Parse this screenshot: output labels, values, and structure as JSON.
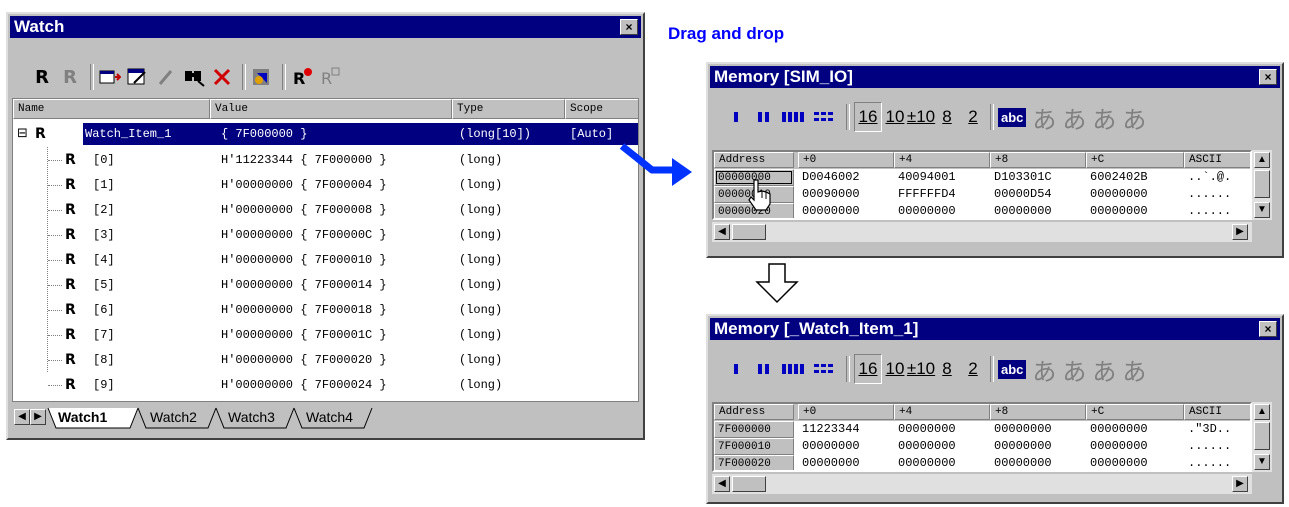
{
  "caption": "Drag and drop",
  "watch": {
    "title": "Watch",
    "close": "×",
    "toolbar": [
      "R",
      "R",
      "▭",
      "▦",
      "/",
      "✎",
      "✕",
      "⚙",
      "R",
      "R"
    ],
    "columns": {
      "name": "Name",
      "value": "Value",
      "type": "Type",
      "scope": "Scope"
    },
    "root": {
      "expander": "⊟",
      "icon": "R",
      "name": "Watch_Item_1",
      "value": "{ 7F000000 }",
      "type": "(long[10])",
      "scope": "[Auto]"
    },
    "items": [
      {
        "name": "[0]",
        "value": "H'11223344 { 7F000000 }",
        "type": "(long)"
      },
      {
        "name": "[1]",
        "value": "H'00000000 { 7F000004 }",
        "type": "(long)"
      },
      {
        "name": "[2]",
        "value": "H'00000000 { 7F000008 }",
        "type": "(long)"
      },
      {
        "name": "[3]",
        "value": "H'00000000 { 7F00000C }",
        "type": "(long)"
      },
      {
        "name": "[4]",
        "value": "H'00000000 { 7F000010 }",
        "type": "(long)"
      },
      {
        "name": "[5]",
        "value": "H'00000000 { 7F000014 }",
        "type": "(long)"
      },
      {
        "name": "[6]",
        "value": "H'00000000 { 7F000018 }",
        "type": "(long)"
      },
      {
        "name": "[7]",
        "value": "H'00000000 { 7F00001C }",
        "type": "(long)"
      },
      {
        "name": "[8]",
        "value": "H'00000000 { 7F000020 }",
        "type": "(long)"
      },
      {
        "name": "[9]",
        "value": "H'00000000 { 7F000024 }",
        "type": "(long)"
      }
    ],
    "tabs": [
      "Watch1",
      "Watch2",
      "Watch3",
      "Watch4"
    ]
  },
  "memory_toolbar": {
    "fmt": [
      "16",
      "10",
      "±10",
      "8",
      "2"
    ],
    "abc": "abc",
    "jp": [
      "あ",
      "あ",
      "あ",
      "あ"
    ]
  },
  "memory1": {
    "title": "Memory [SIM_IO]",
    "headers": [
      "Address",
      "+0",
      "+4",
      "+8",
      "+C",
      "ASCII"
    ],
    "rows": [
      [
        "00000000",
        "D0046002",
        "40094001",
        "D103301C",
        "6002402B",
        "..`.@."
      ],
      [
        "00000010",
        "00090000",
        "FFFFFFD4",
        "00000D54",
        "00000000",
        "......"
      ],
      [
        "00000020",
        "00000000",
        "00000000",
        "00000000",
        "00000000",
        "......"
      ]
    ]
  },
  "memory2": {
    "title": "Memory [_Watch_Item_1]",
    "headers": [
      "Address",
      "+0",
      "+4",
      "+8",
      "+C",
      "ASCII"
    ],
    "rows": [
      [
        "7F000000",
        "11223344",
        "00000000",
        "00000000",
        "00000000",
        ".\"3D.."
      ],
      [
        "7F000010",
        "00000000",
        "00000000",
        "00000000",
        "00000000",
        "......"
      ],
      [
        "7F000020",
        "00000000",
        "00000000",
        "00000000",
        "00000000",
        "......"
      ]
    ]
  },
  "colors": {
    "titlebar": "#000080",
    "selection": "#000080",
    "caption": "#0000ff",
    "arrow": "#0033ff"
  }
}
